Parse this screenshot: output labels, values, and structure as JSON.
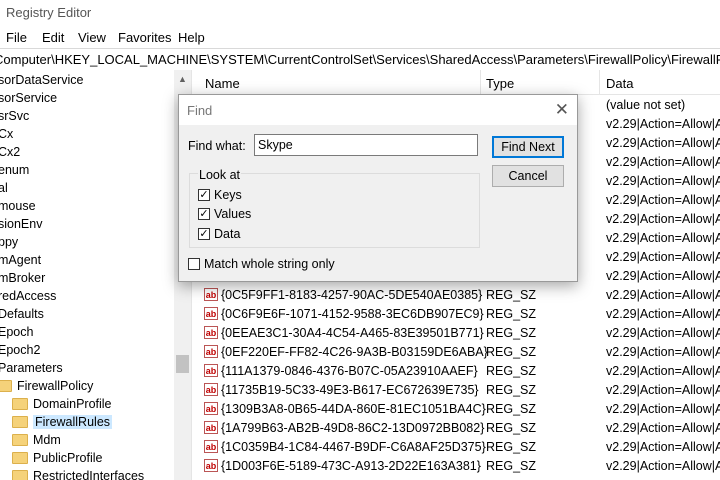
{
  "window": {
    "title": "Registry Editor"
  },
  "menu": [
    "File",
    "Edit",
    "View",
    "Favorites",
    "Help"
  ],
  "address": "Computer\\HKEY_LOCAL_MACHINE\\SYSTEM\\CurrentControlSet\\Services\\SharedAccess\\Parameters\\FirewallPolicy\\FirewallRules",
  "tree": [
    "sorDataService",
    "sorService",
    "srSvc",
    "Cx",
    "Cx2",
    "enum",
    "al",
    "mouse",
    "sionEnv",
    "ppy",
    "mAgent",
    "mBroker",
    "redAccess",
    "Defaults",
    "Epoch",
    "Epoch2",
    "Parameters",
    "FirewallPolicy",
    "DomainProfile",
    "FirewallRules",
    "Mdm",
    "PublicProfile",
    "RestrictedInterfaces"
  ],
  "columns": {
    "name": "Name",
    "type": "Type",
    "data": "Data"
  },
  "rows": [
    {
      "name": "",
      "type": "",
      "data": "(value not set)"
    },
    {
      "name": "",
      "type": "",
      "data": "v2.29|Action=Allow|A"
    },
    {
      "name": "",
      "type": "",
      "data": "v2.29|Action=Allow|A"
    },
    {
      "name": "",
      "type": "",
      "data": "v2.29|Action=Allow|A"
    },
    {
      "name": "",
      "type": "",
      "data": "v2.29|Action=Allow|A"
    },
    {
      "name": "",
      "type": "",
      "data": "v2.29|Action=Allow|A"
    },
    {
      "name": "",
      "type": "",
      "data": "v2.29|Action=Allow|A"
    },
    {
      "name": "",
      "type": "",
      "data": "v2.29|Action=Allow|A"
    },
    {
      "name": "",
      "type": "",
      "data": "v2.29|Action=Allow|A"
    },
    {
      "name": "",
      "type": "",
      "data": "v2.29|Action=Allow|A"
    },
    {
      "name": "{0C5F9FF1-8183-4257-90AC-5DE540AE0385}",
      "type": "REG_SZ",
      "data": "v2.29|Action=Allow|A"
    },
    {
      "name": "{0C6F9E6F-1071-4152-9588-3EC6DB907EC9}",
      "type": "REG_SZ",
      "data": "v2.29|Action=Allow|A"
    },
    {
      "name": "{0EEAE3C1-30A4-4C54-A465-83E39501B771}",
      "type": "REG_SZ",
      "data": "v2.29|Action=Allow|A"
    },
    {
      "name": "{0EF220EF-FF82-4C26-9A3B-B03159DE6ABA}",
      "type": "REG_SZ",
      "data": "v2.29|Action=Allow|A"
    },
    {
      "name": "{111A1379-0846-4376-B07C-05A23910AAEF}",
      "type": "REG_SZ",
      "data": "v2.29|Action=Allow|A"
    },
    {
      "name": "{11735B19-5C33-49E3-B617-EC672639E735}",
      "type": "REG_SZ",
      "data": "v2.29|Action=Allow|A"
    },
    {
      "name": "{1309B3A8-0B65-44DA-860E-81EC1051BA4C}",
      "type": "REG_SZ",
      "data": "v2.29|Action=Allow|A"
    },
    {
      "name": "{1A799B63-AB2B-49D8-86C2-13D0972BB082}",
      "type": "REG_SZ",
      "data": "v2.29|Action=Allow|A"
    },
    {
      "name": "{1C0359B4-1C84-4467-B9DF-C6A8AF25D375}",
      "type": "REG_SZ",
      "data": "v2.29|Action=Allow|A"
    },
    {
      "name": "{1D003F6E-5189-473C-A913-2D22E163A381}",
      "type": "REG_SZ",
      "data": "v2.29|Action=Allow|A"
    }
  ],
  "value_icon": "ab",
  "dialog": {
    "title": "Find",
    "find_label": "Find what:",
    "find_value": "Skype",
    "find_next": "Find Next",
    "cancel": "Cancel",
    "look_at": "Look at",
    "keys": "Keys",
    "values": "Values",
    "data": "Data",
    "match": "Match whole string only",
    "keys_checked": true,
    "values_checked": true,
    "data_checked": true,
    "match_checked": false
  },
  "colors": {
    "selection": "#cce8ff",
    "folder": "#f5d27a",
    "default_button_border": "#0078d7"
  }
}
